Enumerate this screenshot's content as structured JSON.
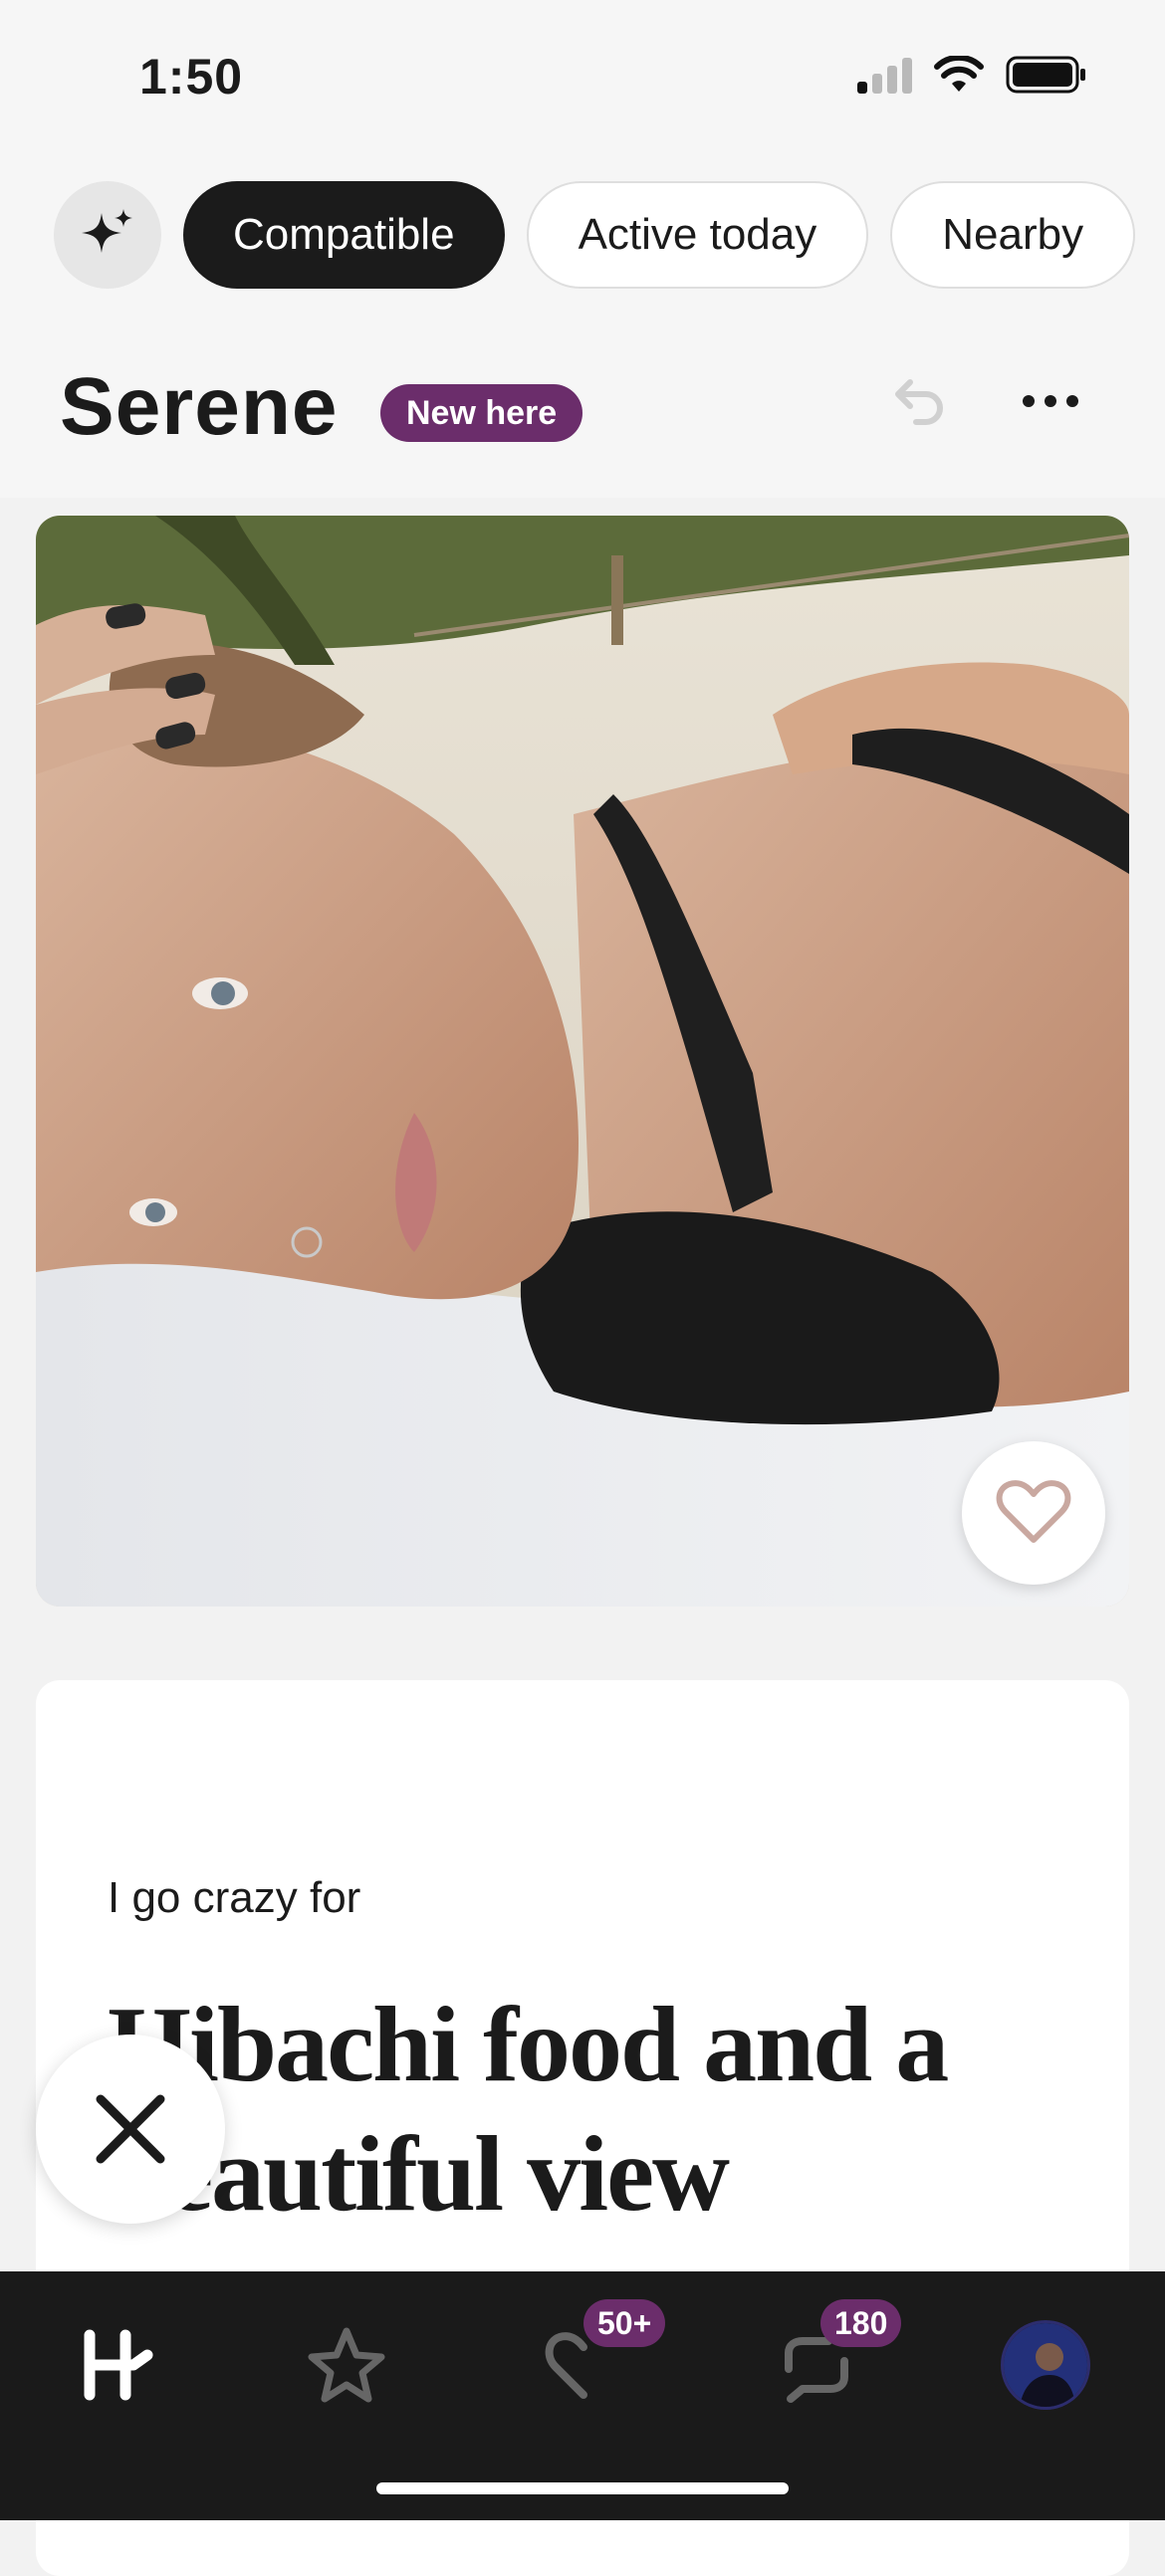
{
  "status_bar": {
    "time": "1:50"
  },
  "filters": {
    "chips": [
      {
        "label": "Compatible",
        "active": true
      },
      {
        "label": "Active today",
        "active": false
      },
      {
        "label": "Nearby",
        "active": false
      }
    ]
  },
  "profile": {
    "name": "Serene",
    "badge": "New here"
  },
  "prompt": {
    "question": "I go crazy for",
    "answer": "Hibachi food and a beautiful view"
  },
  "nav": {
    "likes_count": "50+",
    "messages_count": "180"
  },
  "colors": {
    "accent": "#6b2d6b",
    "dark": "#1b1b1b",
    "nav_background": "#1a1a1a"
  },
  "icons": [
    "sparkle-icon",
    "undo-icon",
    "more-icon",
    "heart-icon",
    "close-icon",
    "home-logo-icon",
    "star-icon",
    "likes-icon",
    "messages-icon"
  ]
}
